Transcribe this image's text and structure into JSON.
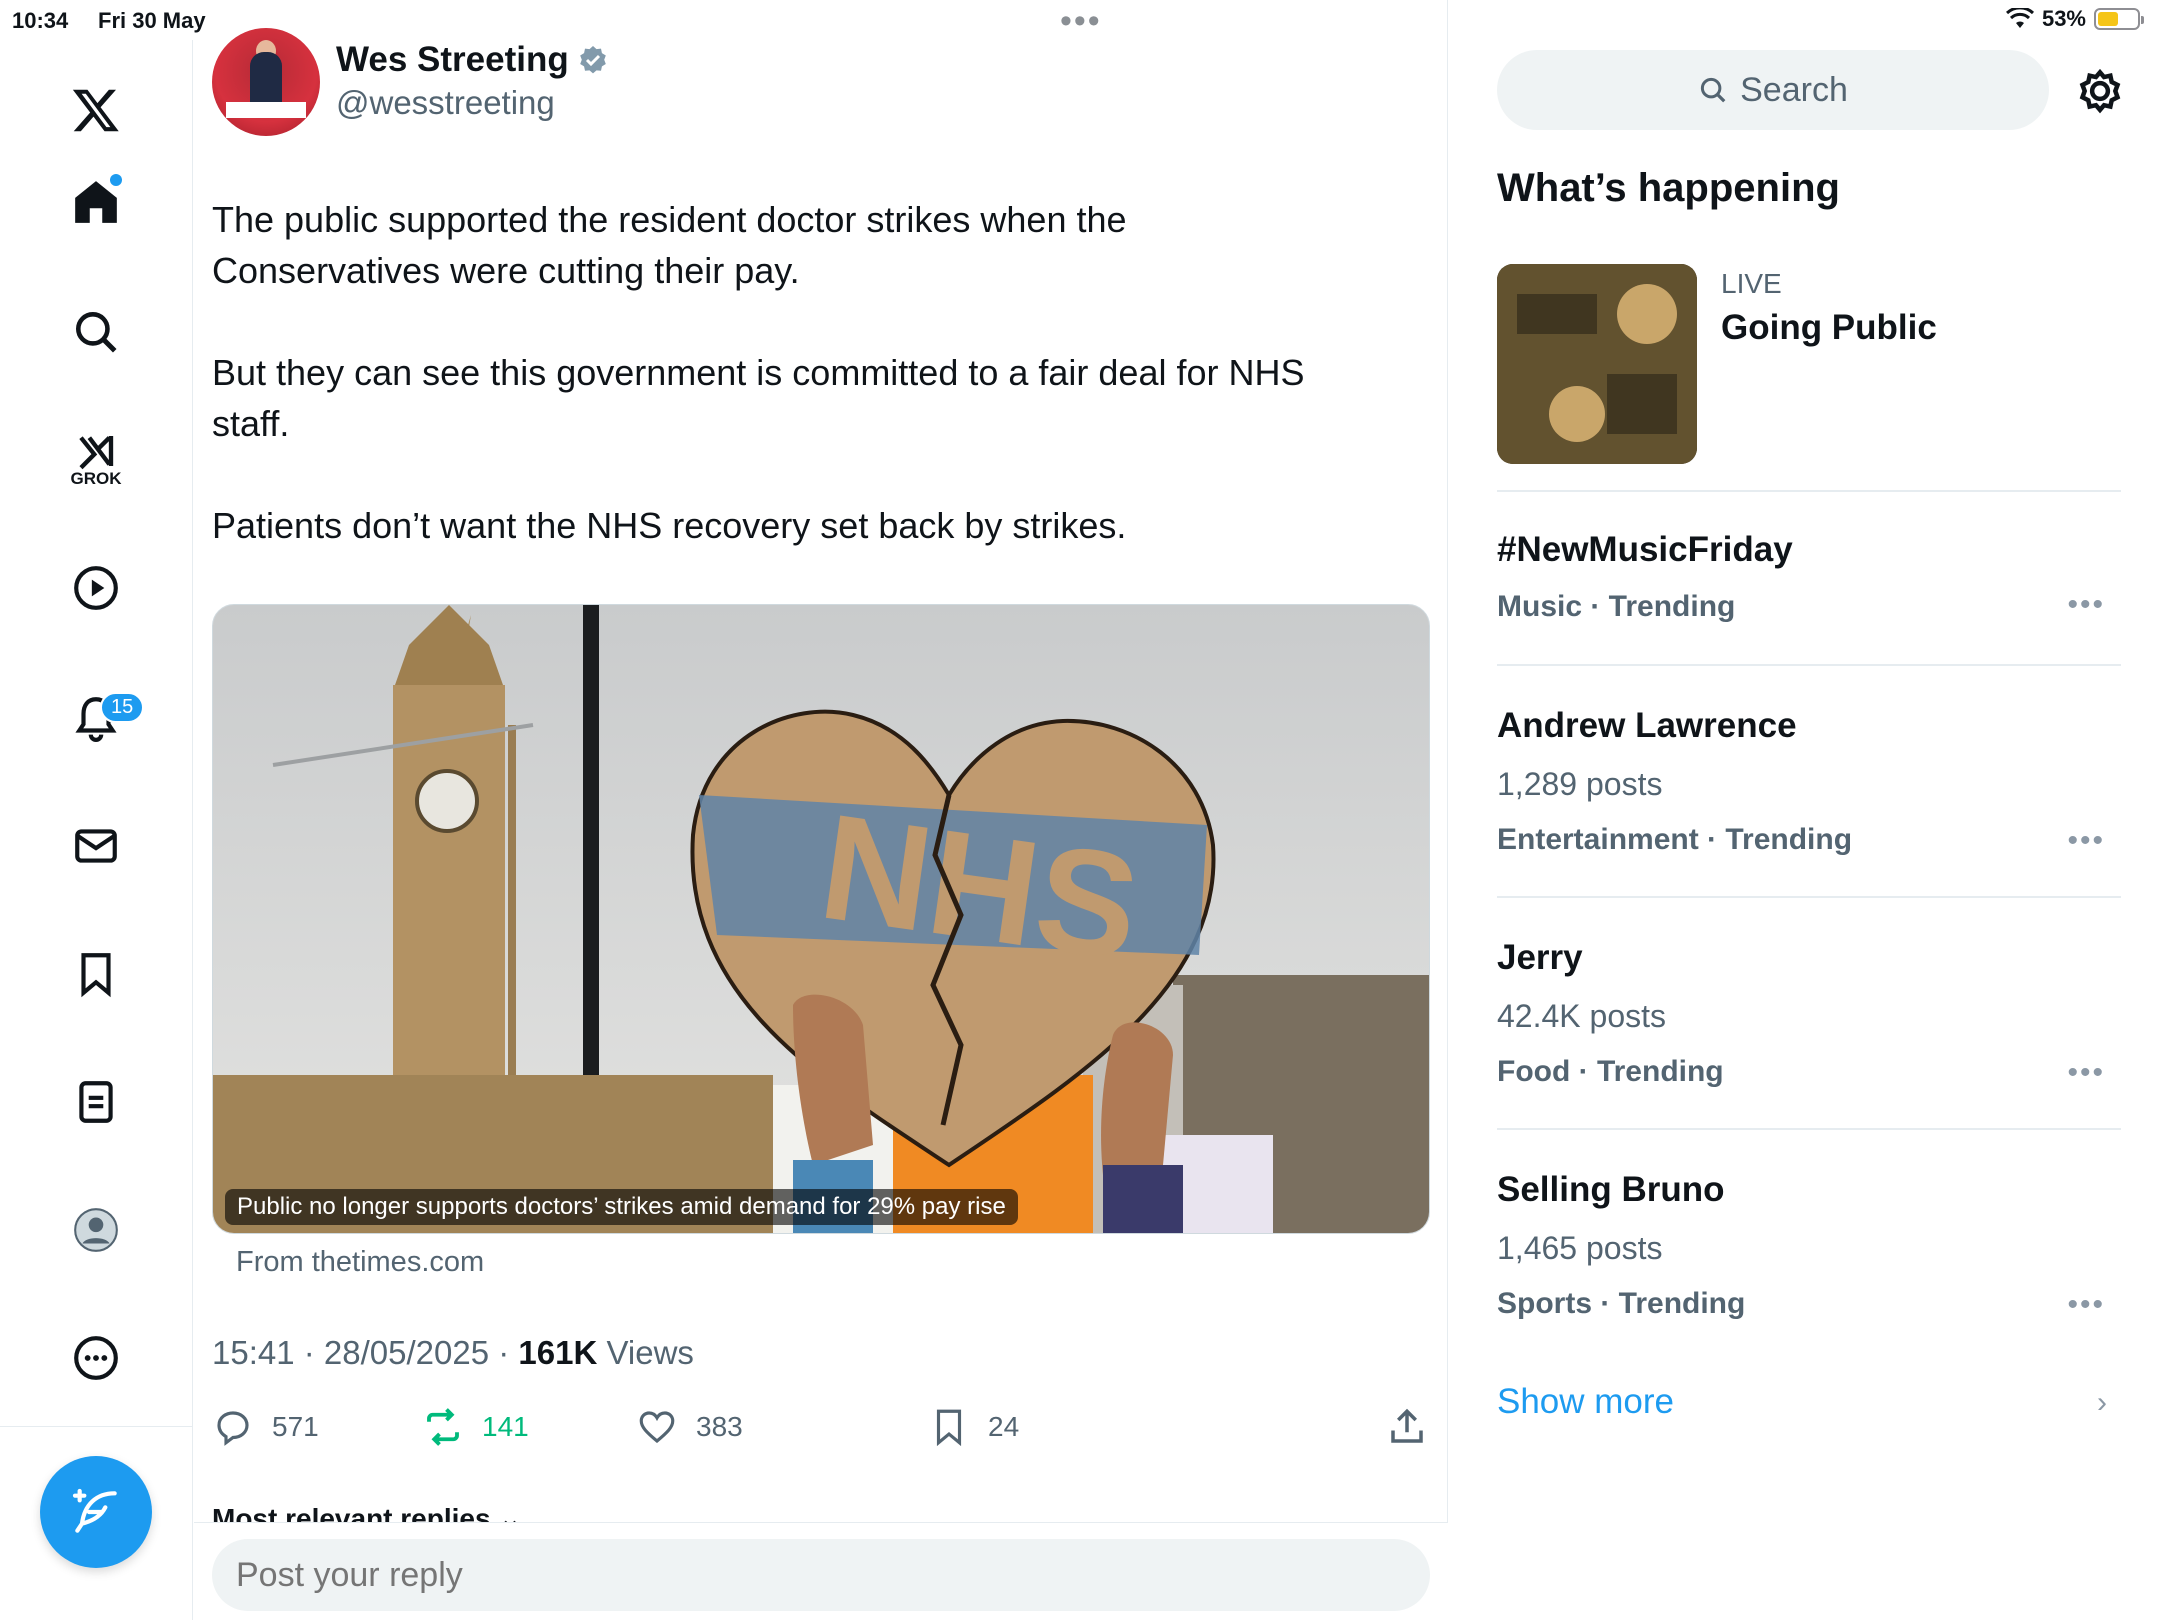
{
  "status_bar": {
    "time": "10:34",
    "date": "Fri 30 May",
    "battery": "53%"
  },
  "nav": {
    "grok_label": "GROK",
    "notification_count": "15"
  },
  "tweet": {
    "author_name": "Wes Streeting",
    "author_handle": "@wesstreeting",
    "text": "The public supported the resident doctor strikes when the\nConservatives were cutting their pay.\n\nBut they can see this government is committed to a fair deal for NHS\nstaff.\n\nPatients don’t want the NHS recovery set back by strikes.",
    "media_caption": "Public no longer supports doctors’ strikes amid demand for 29% pay rise",
    "media_source": "From thetimes.com",
    "timestamp": "15:41 · 28/05/2025 · ",
    "views_count": "161K",
    "views_label": " Views",
    "replies": "571",
    "retweets": "141",
    "likes": "383",
    "bookmarks": "24",
    "replies_header": "Most relevant replies",
    "reply_placeholder": "Post your reply"
  },
  "sidebar": {
    "search_placeholder": "Search",
    "section_title": "What’s happening",
    "live": {
      "label": "LIVE",
      "title": "Going Public"
    },
    "trends": [
      {
        "title": "#NewMusicFriday",
        "posts": "",
        "category": "Music · Trending"
      },
      {
        "title": "Andrew Lawrence",
        "posts": "1,289 posts",
        "category": "Entertainment · Trending"
      },
      {
        "title": "Jerry",
        "posts": "42.4K posts",
        "category": "Food · Trending"
      },
      {
        "title": "Selling Bruno",
        "posts": "1,465 posts",
        "category": "Sports · Trending"
      }
    ],
    "show_more": "Show more"
  },
  "colors": {
    "accent": "#1d9bf0",
    "retweet": "#00ba7c",
    "muted": "#536471"
  }
}
